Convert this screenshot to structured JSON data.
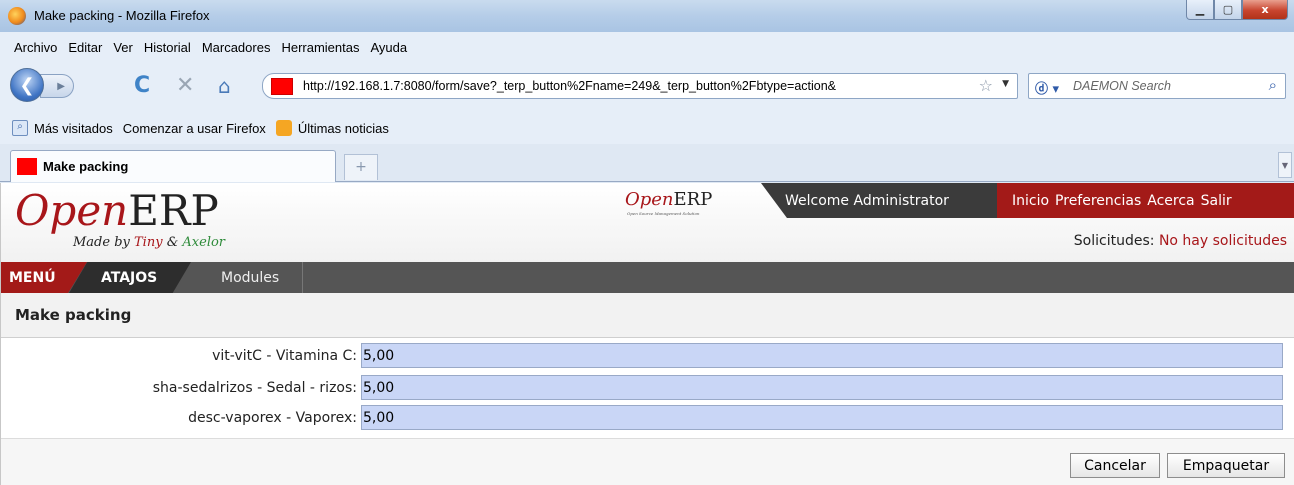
{
  "window": {
    "title": "Make packing - Mozilla Firefox",
    "controls": {
      "minimize": "▁",
      "maximize": "▢",
      "close": "x"
    }
  },
  "menu": [
    "Archivo",
    "Editar",
    "Ver",
    "Historial",
    "Marcadores",
    "Herramientas",
    "Ayuda"
  ],
  "navbar": {
    "url": "http://192.168.1.7:8080/form/save?_terp_button%2Fname=249&_terp_button%2Fbtype=action&",
    "search_placeholder": "DAEMON Search"
  },
  "bookmarks": [
    "Más visitados",
    "Comenzar a usar Firefox",
    "Últimas noticias"
  ],
  "tabs": {
    "active_label": "Make packing",
    "new_tab_glyph": "+"
  },
  "erp": {
    "logo_open": "Open",
    "logo_erp": "ERP",
    "logo_tag_prefix": "Made by ",
    "logo_tag_tiny": "Tiny",
    "logo_tag_amp": " & ",
    "logo_tag_axelor": "Axelor",
    "minilogo_open": "Open",
    "minilogo_erp": "ERP",
    "minilogo_sub": "Open Source Management Solution",
    "welcome": "Welcome Administrator",
    "topnav": [
      "Inicio",
      "Preferencias",
      "Acerca",
      "Salir"
    ],
    "solicitudes_label": "Solicitudes:",
    "solicitudes_value": "No hay solicitudes",
    "menu_tabs": {
      "menu": "MENÚ",
      "atajos": "ATAJOS",
      "modules": "Modules"
    },
    "form_title": "Make packing",
    "fields": [
      {
        "label": "vit-vitC - Vitamina C:",
        "value": "5,00"
      },
      {
        "label": "sha-sedalrizos - Sedal - rizos:",
        "value": "5,00"
      },
      {
        "label": "desc-vaporex - Vaporex:",
        "value": "5,00"
      }
    ],
    "buttons": {
      "cancel": "Cancelar",
      "ok": "Empaquetar"
    }
  },
  "colors": {
    "erp_red": "#a31a18",
    "erp_dark": "#3b3b3b",
    "field_bg": "#c9d6f6"
  }
}
